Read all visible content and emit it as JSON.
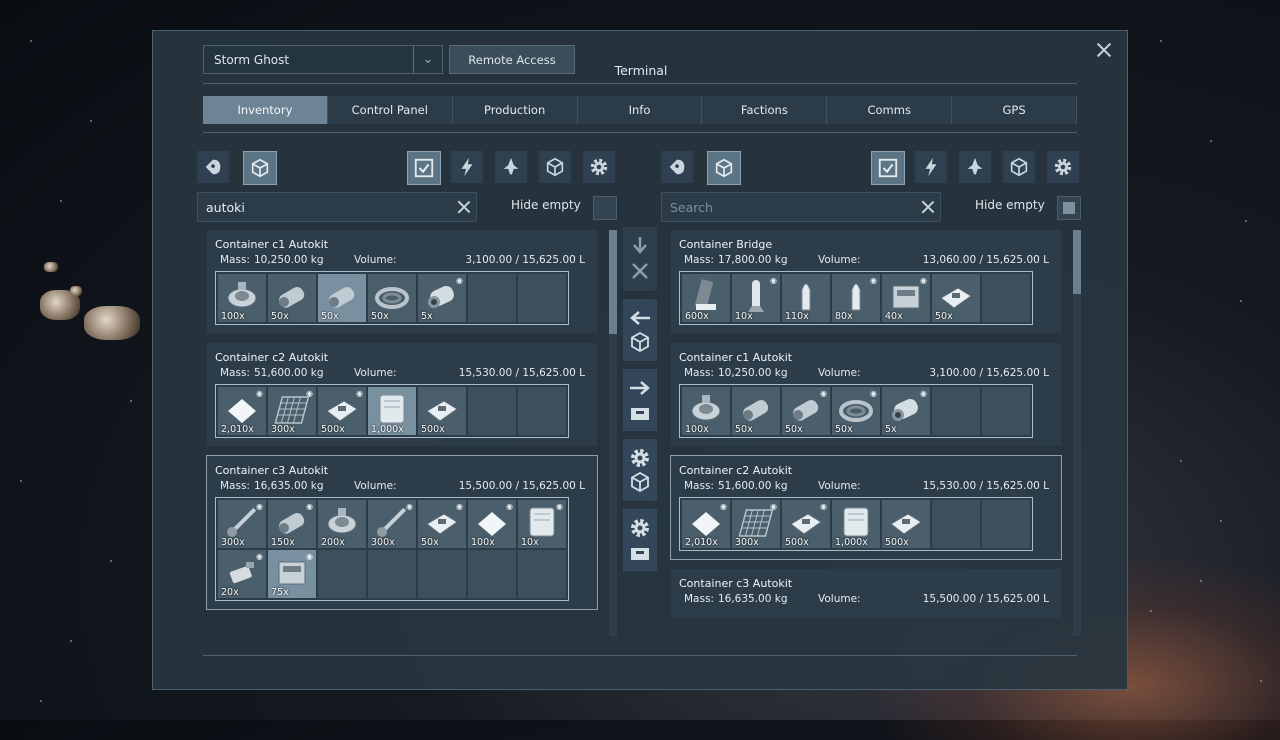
{
  "window": {
    "title": "Terminal",
    "grid_name": "Storm Ghost",
    "remote_access": "Remote Access"
  },
  "tabs": [
    {
      "label": "Inventory",
      "active": true
    },
    {
      "label": "Control Panel",
      "active": false
    },
    {
      "label": "Production",
      "active": false
    },
    {
      "label": "Info",
      "active": false
    },
    {
      "label": "Factions",
      "active": false
    },
    {
      "label": "Comms",
      "active": false
    },
    {
      "label": "GPS",
      "active": false
    }
  ],
  "left": {
    "search_value": "autoki",
    "search_placeholder": "Search",
    "hide_empty": "Hide empty",
    "hide_empty_checked": false,
    "toolbar_icons": [
      "character-icon",
      "grid-icon",
      "checkbox-icon",
      "energy-icon",
      "ship-icon",
      "storage-icon",
      "settings-icon"
    ],
    "containers": [
      {
        "name": "Container c1 Autokit",
        "mass_label": "Mass:",
        "mass": "10,250.00 kg",
        "volume_label": "Volume:",
        "volume": "3,100.00 / 15,625.00 L",
        "slots": [
          {
            "qty": "100x",
            "icon": "motor-icon"
          },
          {
            "qty": "50x",
            "icon": "thruster-component-icon"
          },
          {
            "qty": "50x",
            "icon": "thruster-component-icon",
            "highlight": true
          },
          {
            "qty": "50x",
            "icon": "coil-icon"
          },
          {
            "qty": "5x",
            "icon": "reactor-component-icon",
            "pin": true
          },
          {},
          {}
        ]
      },
      {
        "name": "Container c2 Autokit",
        "mass_label": "Mass:",
        "mass": "51,600.00 kg",
        "volume_label": "Volume:",
        "volume": "15,530.00 / 15,625.00 L",
        "slots": [
          {
            "qty": "2,010x",
            "icon": "plate-icon",
            "pin": true
          },
          {
            "qty": "300x",
            "icon": "grid-mesh-icon",
            "pin": true
          },
          {
            "qty": "500x",
            "icon": "panel-icon",
            "pin": true
          },
          {
            "qty": "1,000x",
            "icon": "canister-icon",
            "highlight": true
          },
          {
            "qty": "500x",
            "icon": "panel-icon"
          },
          {},
          {}
        ]
      },
      {
        "name": "Container c3 Autokit",
        "mass_label": "Mass:",
        "mass": "16,635.00 kg",
        "volume_label": "Volume:",
        "volume": "15,500.00 / 15,625.00 L",
        "selected": true,
        "slots": [
          {
            "qty": "300x",
            "icon": "rod-icon",
            "pin": true
          },
          {
            "qty": "150x",
            "icon": "thruster-component-icon",
            "pin": true
          },
          {
            "qty": "200x",
            "icon": "motor-icon"
          },
          {
            "qty": "300x",
            "icon": "rod-icon",
            "pin": true
          },
          {
            "qty": "50x",
            "icon": "panel-icon",
            "pin": true
          },
          {
            "qty": "100x",
            "icon": "plate-icon",
            "pin": true
          },
          {
            "qty": "10x",
            "icon": "canister-icon",
            "pin": true
          },
          {
            "qty": "20x",
            "icon": "tool-icon",
            "pin": true
          },
          {
            "qty": "75x",
            "icon": "box-icon",
            "pin": true,
            "highlight": true
          },
          {},
          {},
          {},
          {},
          {}
        ]
      }
    ]
  },
  "right": {
    "search_value": "",
    "search_placeholder": "Search",
    "hide_empty": "Hide empty",
    "hide_empty_checked": true,
    "containers": [
      {
        "name": "Container Bridge",
        "mass_label": "Mass:",
        "mass": "17,800.00 kg",
        "volume_label": "Volume:",
        "volume": "13,060.00 / 15,625.00 L",
        "slots": [
          {
            "qty": "600x",
            "icon": "ammo-mag-icon"
          },
          {
            "qty": "10x",
            "icon": "missile-icon",
            "pin": true
          },
          {
            "qty": "110x",
            "icon": "bullet-icon"
          },
          {
            "qty": "80x",
            "icon": "bullet-icon",
            "pin": true
          },
          {
            "qty": "40x",
            "icon": "box-icon",
            "pin": true
          },
          {
            "qty": "50x",
            "icon": "panel-icon"
          },
          {}
        ]
      },
      {
        "name": "Container c1 Autokit",
        "mass_label": "Mass:",
        "mass": "10,250.00 kg",
        "volume_label": "Volume:",
        "volume": "3,100.00 / 15,625.00 L",
        "slots": [
          {
            "qty": "100x",
            "icon": "motor-icon"
          },
          {
            "qty": "50x",
            "icon": "thruster-component-icon"
          },
          {
            "qty": "50x",
            "icon": "thruster-component-icon",
            "pin": true
          },
          {
            "qty": "50x",
            "icon": "coil-icon",
            "pin": true
          },
          {
            "qty": "5x",
            "icon": "reactor-component-icon",
            "pin": true
          },
          {},
          {}
        ]
      },
      {
        "name": "Container c2 Autokit",
        "mass_label": "Mass:",
        "mass": "51,600.00 kg",
        "volume_label": "Volume:",
        "volume": "15,530.00 / 15,625.00 L",
        "selected": true,
        "slots": [
          {
            "qty": "2,010x",
            "icon": "plate-icon",
            "pin": true
          },
          {
            "qty": "300x",
            "icon": "grid-mesh-icon",
            "pin": true
          },
          {
            "qty": "500x",
            "icon": "panel-icon",
            "pin": true
          },
          {
            "qty": "1,000x",
            "icon": "canister-icon"
          },
          {
            "qty": "500x",
            "icon": "panel-icon"
          },
          {},
          {}
        ]
      },
      {
        "name": "Container c3 Autokit",
        "mass_label": "Mass:",
        "mass": "16,635.00 kg",
        "volume_label": "Volume:",
        "volume": "15,500.00 / 15,625.00 L",
        "slots": []
      }
    ]
  }
}
